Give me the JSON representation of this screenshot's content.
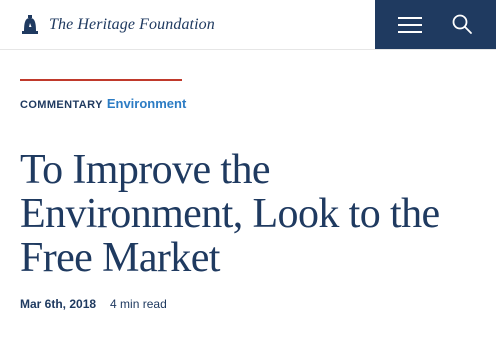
{
  "header": {
    "site_name": "The Heritage Foundation",
    "logo_icon": "liberty-bell-icon",
    "menu_icon": "hamburger-menu-icon",
    "search_icon": "search-icon",
    "actions_bg_color": "#1f3a60"
  },
  "article": {
    "type_label": "COMMENTARY",
    "topic_label": "Environment",
    "title": "To Improve the Environment, Look to the Free Market",
    "date": "Mar 6th, 2018",
    "read_time": "4 min read"
  },
  "colors": {
    "brand_navy": "#1f3a60",
    "accent_red": "#c0392b",
    "topic_blue": "#2c7cc4"
  }
}
